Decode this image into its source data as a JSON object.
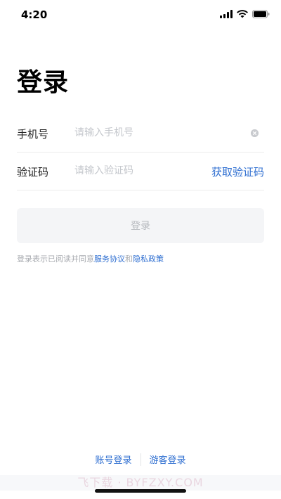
{
  "status_bar": {
    "time": "4:20"
  },
  "page": {
    "title": "登录"
  },
  "form": {
    "phone": {
      "label": "手机号",
      "placeholder": "请输入手机号",
      "value": ""
    },
    "code": {
      "label": "验证码",
      "placeholder": "请输入验证码",
      "value": "",
      "get_code_label": "获取验证码"
    },
    "login_button_label": "登录"
  },
  "agreement": {
    "prefix": "登录表示已阅读并同意",
    "service_link": "服务协议",
    "and": "和",
    "privacy_link": "隐私政策"
  },
  "bottom_options": {
    "account_login": "账号登录",
    "guest_login": "游客登录"
  },
  "watermark": {
    "text": "飞下载 · BYFZXY.COM"
  },
  "colors": {
    "accent": "#2f6fd1",
    "placeholder": "#c4c7cc",
    "disabled_button_bg": "#f4f5f7",
    "disabled_button_text": "#b6b9be"
  },
  "icons": {
    "signal": "cellular-signal-icon",
    "wifi": "wifi-icon",
    "battery": "battery-icon",
    "clear": "clear-icon"
  }
}
